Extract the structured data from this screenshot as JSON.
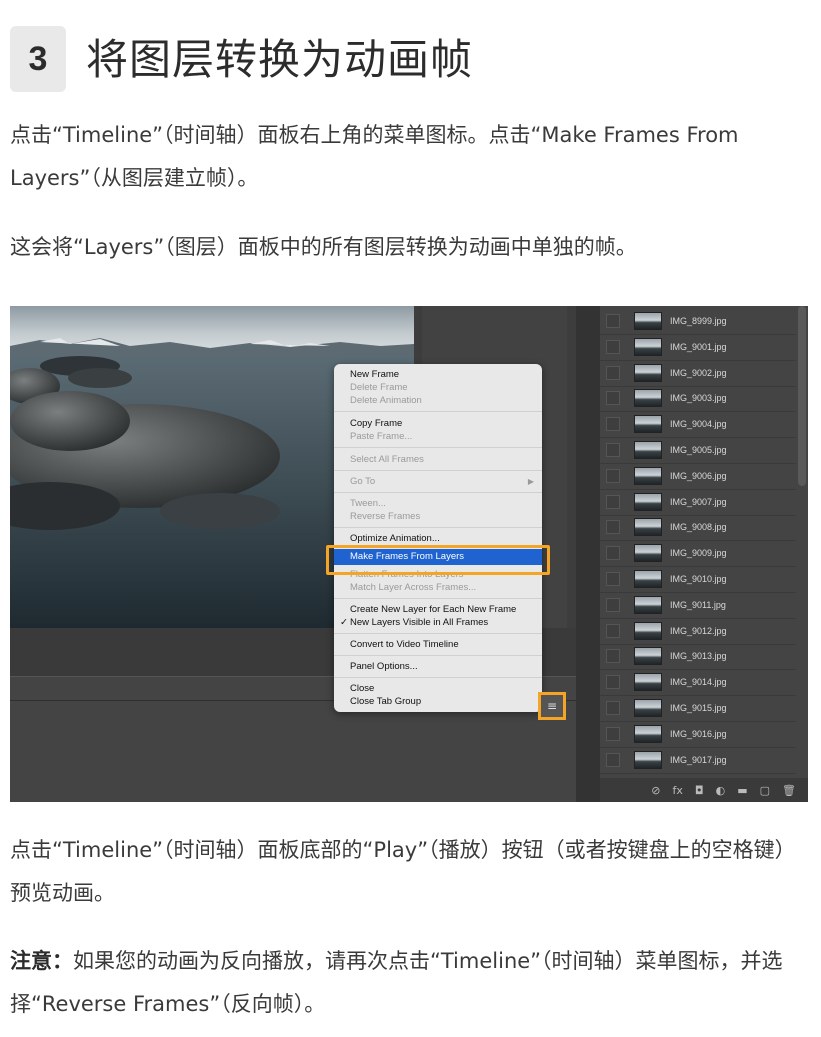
{
  "step": {
    "number": "3",
    "title": "将图层转换为动画帧"
  },
  "paragraphs": {
    "p1": "点击“Timeline”（时间轴）面板右上角的菜单图标。点击“Make Frames From Layers”（从图层建立帧）。",
    "p2": "这会将“Layers”（图层）面板中的所有图层转换为动画中单独的帧。",
    "p3": "点击“Timeline”（时间轴）面板底部的“Play”（播放）按钮（或者按键盘上的空格键）预览动画。",
    "p4_bold": "注意：",
    "p4_rest": "如果您的动画为反向播放，请再次点击“Timeline”（时间轴）菜单图标，并选择“Reverse Frames”（反向帧）。"
  },
  "menu": {
    "items": [
      {
        "label": "New Frame",
        "enabled": true
      },
      {
        "label": "Delete Frame",
        "enabled": false
      },
      {
        "label": "Delete Animation",
        "enabled": false
      },
      {
        "label": "Copy Frame",
        "enabled": true
      },
      {
        "label": "Paste Frame...",
        "enabled": false
      },
      {
        "label": "Select All Frames",
        "enabled": false
      },
      {
        "label": "Go To",
        "enabled": false
      },
      {
        "label": "Tween...",
        "enabled": false
      },
      {
        "label": "Reverse Frames",
        "enabled": false
      },
      {
        "label": "Optimize Animation...",
        "enabled": true
      },
      {
        "label": "Make Frames From Layers",
        "enabled": true,
        "selected": true
      },
      {
        "label": "Flatten Frames Into Layers",
        "enabled": false
      },
      {
        "label": "Match Layer Across Frames...",
        "enabled": false
      },
      {
        "label": "Create New Layer for Each New Frame",
        "enabled": true
      },
      {
        "label": "New Layers Visible in All Frames",
        "enabled": true,
        "checked": true
      },
      {
        "label": "Convert to Video Timeline",
        "enabled": true
      },
      {
        "label": "Panel Options...",
        "enabled": true
      },
      {
        "label": "Close",
        "enabled": true
      },
      {
        "label": "Close Tab Group",
        "enabled": true
      }
    ],
    "submenu_arrow": "▶",
    "checkmark": "✓"
  },
  "layers": [
    "IMG_8999.jpg",
    "IMG_9001.jpg",
    "IMG_9002.jpg",
    "IMG_9003.jpg",
    "IMG_9004.jpg",
    "IMG_9005.jpg",
    "IMG_9006.jpg",
    "IMG_9007.jpg",
    "IMG_9008.jpg",
    "IMG_9009.jpg",
    "IMG_9010.jpg",
    "IMG_9011.jpg",
    "IMG_9012.jpg",
    "IMG_9013.jpg",
    "IMG_9014.jpg",
    "IMG_9015.jpg",
    "IMG_9016.jpg",
    "IMG_9017.jpg"
  ],
  "layers_footer_icons": [
    "link-icon",
    "fx-icon",
    "mask-icon",
    "adjustment-icon",
    "folder-icon",
    "new-layer-icon",
    "trash-icon"
  ],
  "layers_footer_glyphs": [
    "⊘",
    "fx",
    "◘",
    "◐",
    "▬",
    "▢",
    "🗑"
  ],
  "menu_button_glyph": "≡",
  "colors": {
    "highlight": "#f4a526",
    "selection": "#1f63d1"
  }
}
